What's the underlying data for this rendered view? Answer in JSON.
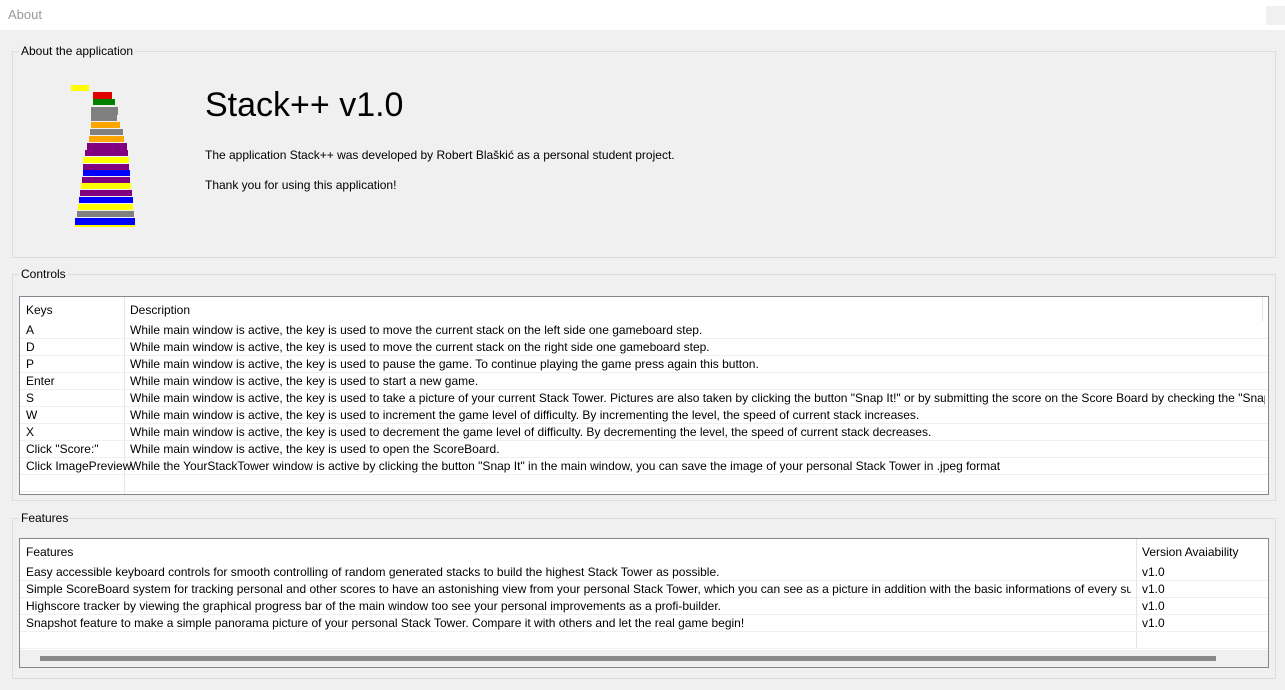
{
  "window": {
    "title": "About"
  },
  "about": {
    "group_label": "About the application",
    "app_title": "Stack++ v1.0",
    "description": "The application Stack++ was developed by Robert Blaškić as a personal student project.",
    "thanks": "Thank you for using this application!",
    "logo_colors": [
      "#ffff00",
      "#e00000",
      "#008000",
      "#808080",
      "#808080",
      "#ffa500",
      "#808080",
      "#ffa500",
      "#800080",
      "#800080",
      "#ffff00",
      "#800080",
      "#0000ff",
      "#800080",
      "#ffff00",
      "#800080",
      "#0000ff",
      "#ffff00",
      "#808080",
      "#0000ff"
    ]
  },
  "controls": {
    "group_label": "Controls",
    "columns": [
      "Keys",
      "Description"
    ],
    "rows": [
      {
        "key": "A",
        "desc": "While main window is active, the key is used to move the current stack on the left side one gameboard step."
      },
      {
        "key": "D",
        "desc": "While main window is active, the key is used to move the current stack on the right side one gameboard step."
      },
      {
        "key": "P",
        "desc": "While main window is active, the key is used to pause the game. To continue playing the game press again this button."
      },
      {
        "key": "Enter",
        "desc": "While main window is active, the key is used to start a new game."
      },
      {
        "key": "S",
        "desc": "While main window is active, the key is used to take a picture of your current Stack Tower. Pictures are also taken by clicking the button \"Snap It!\" or by submitting the score on the Score Board by checking the \"Snapshot\" checkbox."
      },
      {
        "key": "W",
        "desc": "While main window is active, the key is used to increment the game level of difficulty. By incrementing the level, the speed of current stack increases."
      },
      {
        "key": "X",
        "desc": "While main window is active, the key is used to decrement the game level of difficulty. By decrementing the level, the speed of current stack decreases."
      },
      {
        "key": "Click \"Score:\"",
        "desc": "While main window is active, the key is used to open the ScoreBoard."
      },
      {
        "key": "Click ImagePreview",
        "desc": "While the YourStackTower window is active by clicking the button \"Snap It\" in the main window, you can save the image of your personal Stack Tower in .jpeg format"
      }
    ]
  },
  "features": {
    "group_label": "Features",
    "columns": [
      "Features",
      "Version Avaiability"
    ],
    "rows": [
      {
        "feature": "Easy accessible keyboard controls for smooth controlling of random generated stacks to build the highest Stack Tower as possible.",
        "version": "v1.0"
      },
      {
        "feature": "Simple ScoreBoard system for tracking personal and other scores to have an astonishing view from your personal Stack Tower, which you can see as a picture in addition with the basic informations of every succeed score.",
        "version": "v1.0"
      },
      {
        "feature": "Highscore tracker by viewing the graphical progress bar of the main window too see your personal improvements as a profi-builder.",
        "version": "v1.0"
      },
      {
        "feature": "Snapshot feature to make a simple panorama picture of your personal Stack Tower. Compare it with others and let the real game begin!",
        "version": "v1.0"
      }
    ]
  }
}
